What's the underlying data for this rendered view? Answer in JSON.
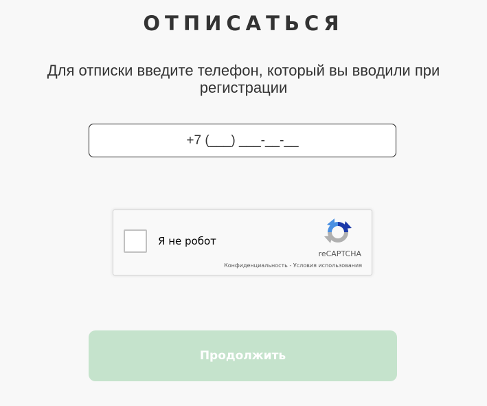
{
  "page": {
    "title": "ОТПИСАТЬСЯ",
    "subtitle": "Для отписки введите телефон, который вы вводили при регистрации"
  },
  "phone": {
    "value": "",
    "placeholder": "+7 (___) ___-__-__"
  },
  "captcha": {
    "label": "Я не робот",
    "brand": "reCAPTCHA",
    "privacy_link": "Конфиденциальность",
    "separator": " - ",
    "terms_link": "Условия использования",
    "logo_icon": "recaptcha-logo-icon",
    "checked": false
  },
  "actions": {
    "continue_label": "Продолжить",
    "continue_color": "#c5e3cc"
  },
  "colors": {
    "background": "#f8f8f8",
    "text": "#333333"
  }
}
